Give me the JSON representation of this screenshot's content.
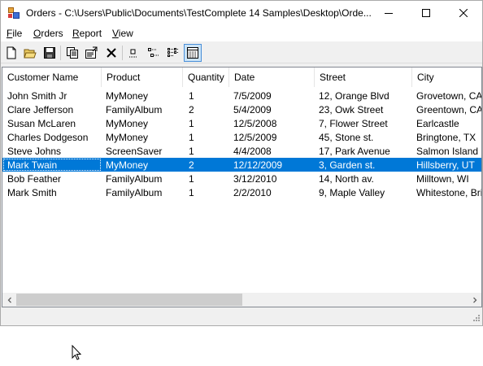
{
  "window": {
    "title": "Orders - C:\\Users\\Public\\Documents\\TestComplete 14 Samples\\Desktop\\Orde..."
  },
  "menu": {
    "file": {
      "acc": "F",
      "rest": "ile"
    },
    "orders": {
      "acc": "O",
      "rest": "rders"
    },
    "report": {
      "acc": "R",
      "rest": "eport"
    },
    "view": {
      "acc": "V",
      "rest": "iew"
    }
  },
  "toolbar": {
    "icons": [
      "new-icon",
      "open-icon",
      "save-icon",
      "copy-icon",
      "properties-icon",
      "delete-icon",
      "large-icons-icon",
      "small-icons-icon",
      "list-icon",
      "details-icon"
    ],
    "active_view": "details"
  },
  "columns": [
    "Customer Name",
    "Product",
    "Quantity",
    "Date",
    "Street",
    "City"
  ],
  "rows": [
    {
      "customer": "John Smith Jr",
      "product": "MyMoney",
      "quantity": "1",
      "date": "7/5/2009",
      "street": "12, Orange Blvd",
      "city": "Grovetown, CA"
    },
    {
      "customer": "Clare Jefferson",
      "product": "FamilyAlbum",
      "quantity": "2",
      "date": "5/4/2009",
      "street": "23, Owk Street",
      "city": "Greentown, CA"
    },
    {
      "customer": "Susan McLaren",
      "product": "MyMoney",
      "quantity": "1",
      "date": "12/5/2008",
      "street": "7, Flower Street",
      "city": "Earlcastle"
    },
    {
      "customer": "Charles Dodgeson",
      "product": "MyMoney",
      "quantity": "1",
      "date": "12/5/2009",
      "street": "45, Stone st.",
      "city": "Bringtone, TX"
    },
    {
      "customer": "Steve Johns",
      "product": "ScreenSaver",
      "quantity": "1",
      "date": "4/4/2008",
      "street": "17, Park Avenue",
      "city": "Salmon Island"
    },
    {
      "customer": "Mark Twain",
      "product": "MyMoney",
      "quantity": "2",
      "date": "12/12/2009",
      "street": "3, Garden st.",
      "city": "Hillsberry, UT",
      "selected": true
    },
    {
      "customer": "Bob Feather",
      "product": "FamilyAlbum",
      "quantity": "1",
      "date": "3/12/2010",
      "street": "14, North av.",
      "city": "Milltown, WI"
    },
    {
      "customer": "Mark Smith",
      "product": "FamilyAlbum",
      "quantity": "1",
      "date": "2/2/2010",
      "street": "9, Maple Valley",
      "city": "Whitestone, Britis"
    }
  ],
  "scroll": {
    "horizontal_position": 0,
    "visible_fraction": 0.5
  },
  "colors": {
    "selection": "#0078d7",
    "selection_text": "#ffffff"
  }
}
